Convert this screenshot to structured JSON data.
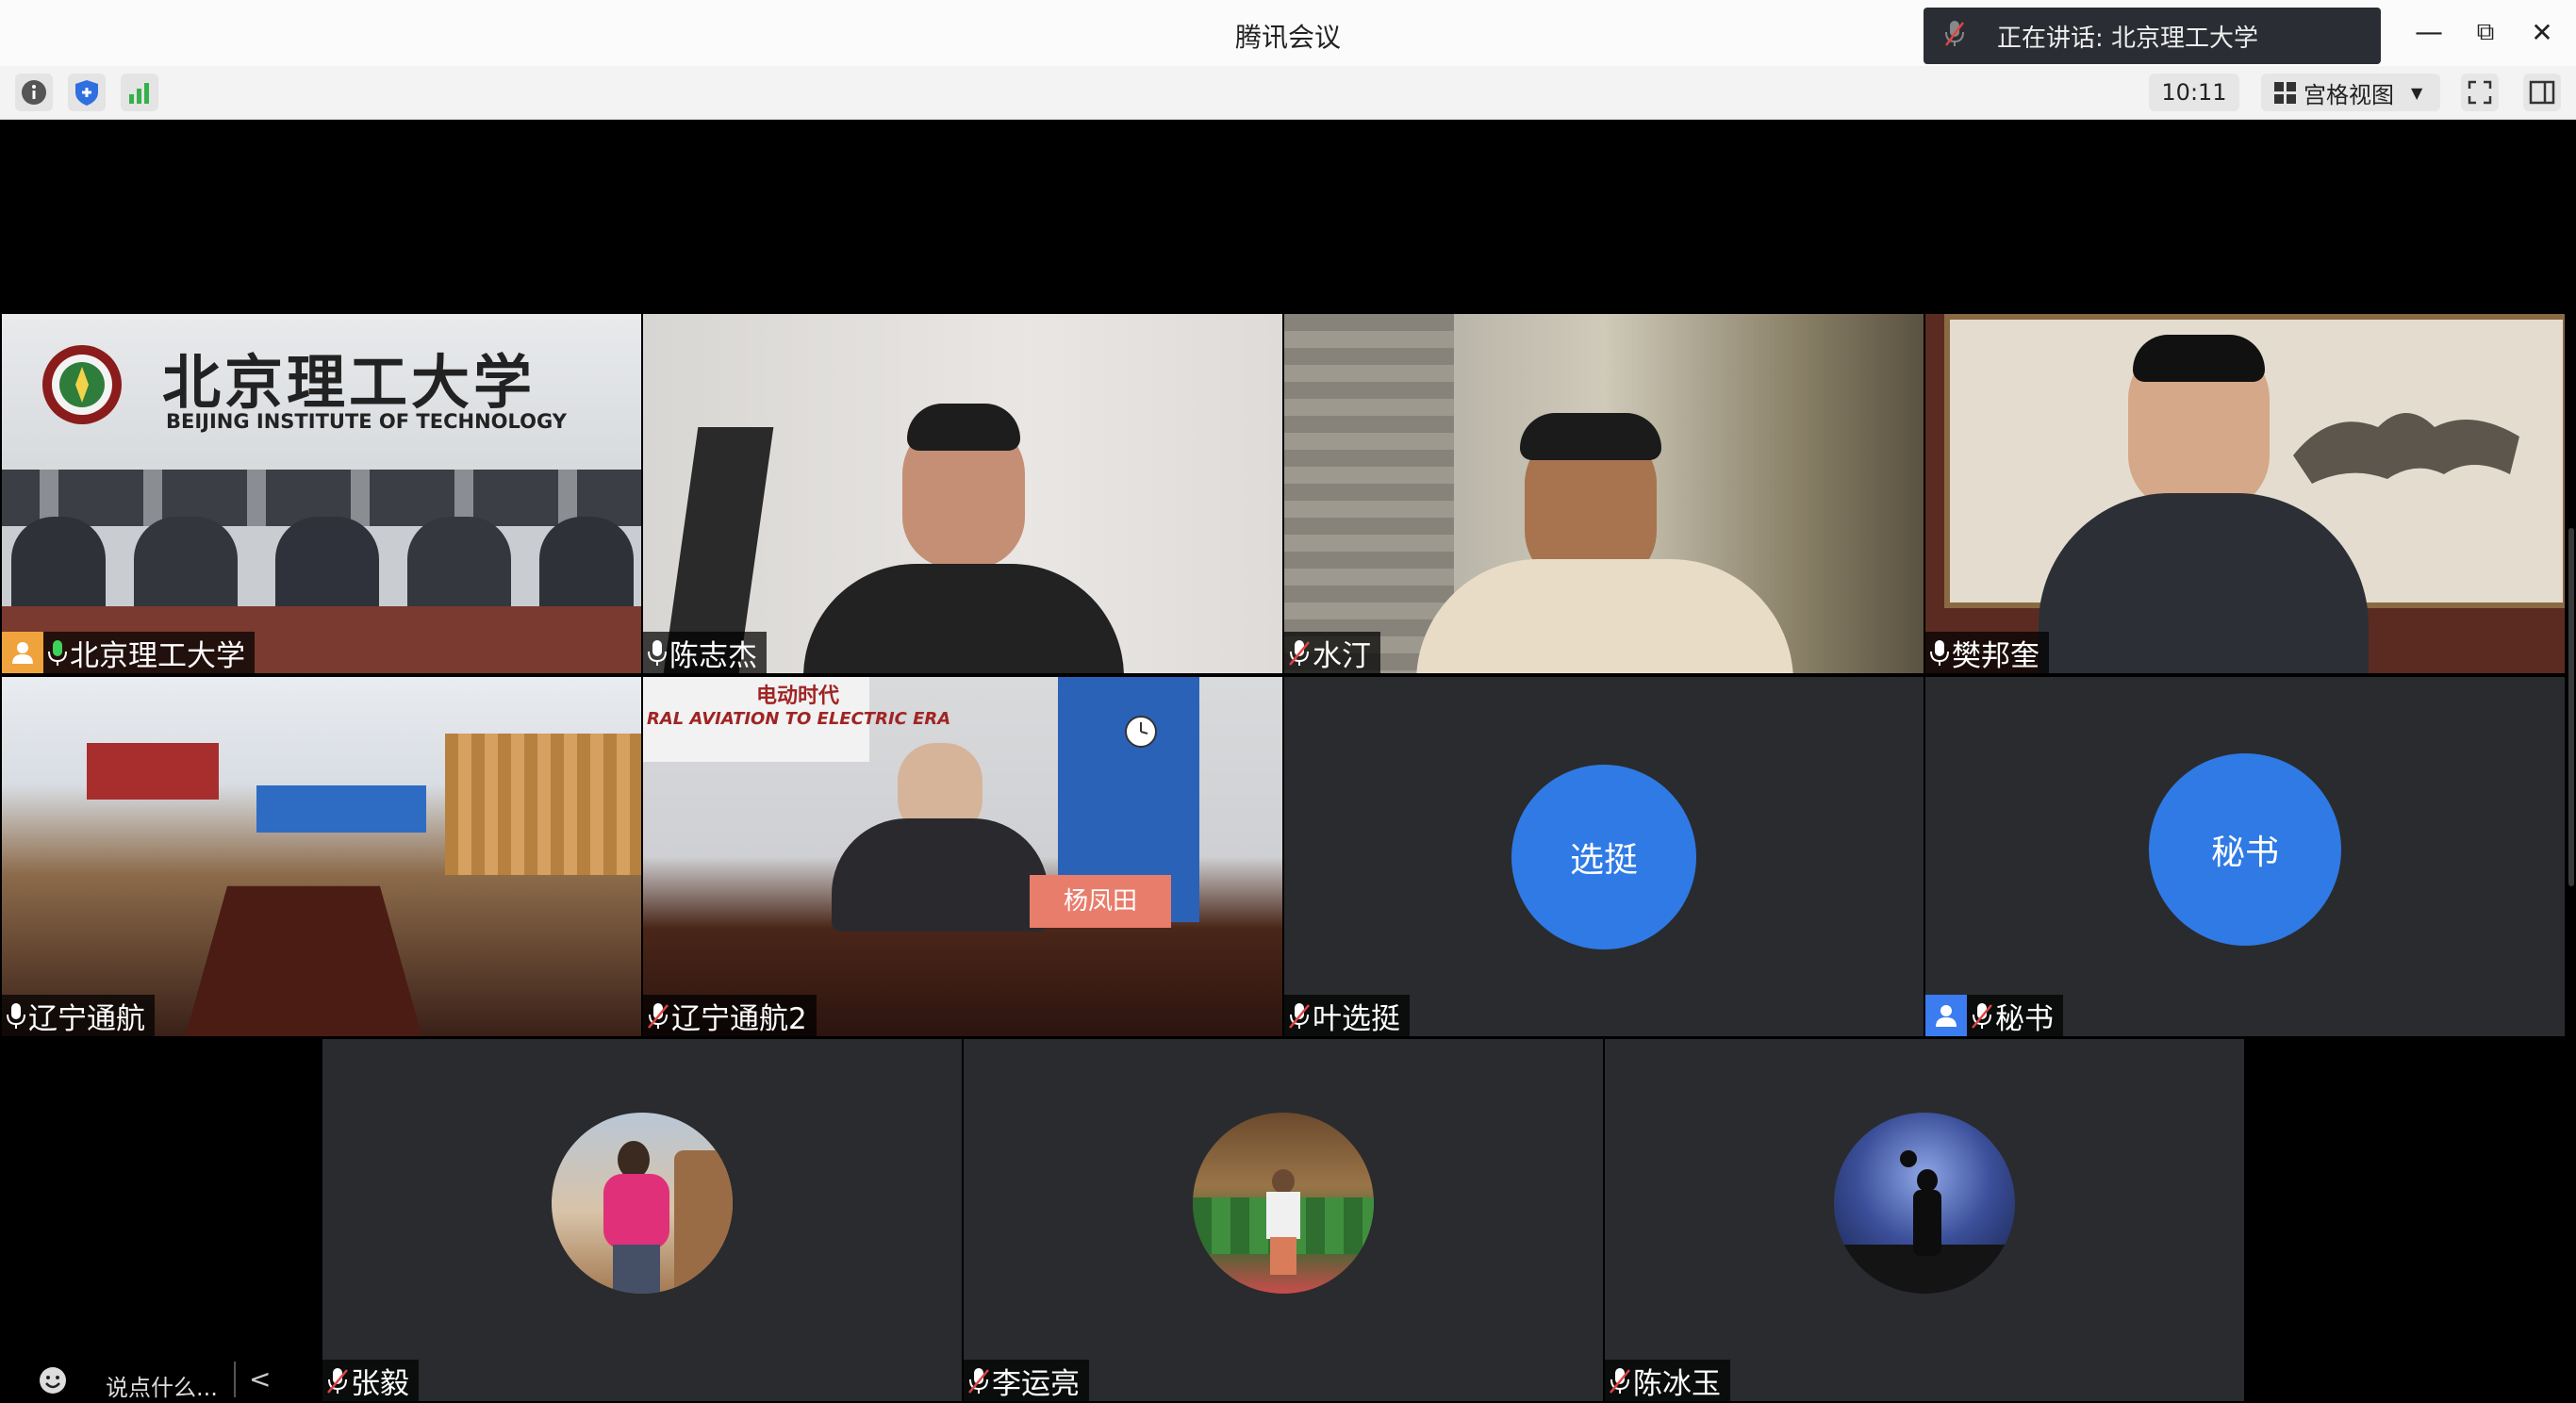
{
  "window": {
    "title": "腾讯会议",
    "speaking_label": "正在讲话: 北京理工大学",
    "minimize_glyph": "—",
    "restore_glyph": "⧉",
    "close_glyph": "✕"
  },
  "toolbar": {
    "time": "10:11",
    "view_label": "宫格视图"
  },
  "tiles": [
    {
      "name": "北京理工大学",
      "type": "video",
      "mic": "on"
    },
    {
      "name": "陈志杰",
      "type": "video",
      "mic": "on"
    },
    {
      "name": "水汀",
      "type": "video",
      "mic": "off"
    },
    {
      "name": "樊邦奎",
      "type": "video",
      "mic": "on"
    },
    {
      "name": "辽宁通航",
      "type": "video",
      "mic": "on"
    },
    {
      "name": "辽宁通航2",
      "type": "video",
      "mic": "off"
    },
    {
      "name": "叶选挺",
      "type": "avatar",
      "avatar_text": "选挺",
      "mic": "off"
    },
    {
      "name": "秘书",
      "type": "avatar",
      "avatar_text": "秘书",
      "mic": "off"
    },
    {
      "name": "张毅",
      "type": "photo",
      "mic": "off"
    },
    {
      "name": "李运亮",
      "type": "photo",
      "mic": "off"
    },
    {
      "name": "陈冰玉",
      "type": "photo",
      "mic": "off"
    }
  ],
  "video_text": {
    "bit_logo_cn": "北京理工大学",
    "bit_logo_en": "BEIJING INSTITUTE OF TECHNOLOGY",
    "banner_en": "RAL AVIATION TO ELECTRIC ERA",
    "banner_cn": "电动时代",
    "nameplate": "杨凤田"
  },
  "chat": {
    "placeholder": "说点什么...",
    "collapse_glyph": "<"
  },
  "colors": {
    "avatar_blue": "#2f7ae5",
    "tile_dark": "#2a2b2e",
    "speaking_bg": "#2a2d33"
  }
}
